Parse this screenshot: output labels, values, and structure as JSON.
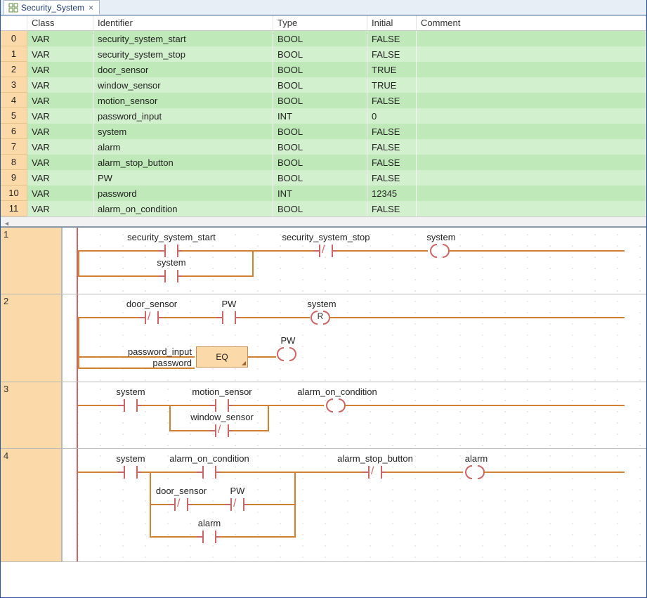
{
  "tab": {
    "title": "Security_System",
    "close": "×"
  },
  "vartable": {
    "headers": {
      "class": "Class",
      "identifier": "Identifier",
      "type": "Type",
      "initial": "Initial",
      "comment": "Comment"
    },
    "rows": [
      {
        "idx": "0",
        "class": "VAR",
        "identifier": "security_system_start",
        "type": "BOOL",
        "initial": "FALSE",
        "comment": ""
      },
      {
        "idx": "1",
        "class": "VAR",
        "identifier": "security_system_stop",
        "type": "BOOL",
        "initial": "FALSE",
        "comment": ""
      },
      {
        "idx": "2",
        "class": "VAR",
        "identifier": "door_sensor",
        "type": "BOOL",
        "initial": "TRUE",
        "comment": ""
      },
      {
        "idx": "3",
        "class": "VAR",
        "identifier": "window_sensor",
        "type": "BOOL",
        "initial": "TRUE",
        "comment": ""
      },
      {
        "idx": "4",
        "class": "VAR",
        "identifier": "motion_sensor",
        "type": "BOOL",
        "initial": "FALSE",
        "comment": ""
      },
      {
        "idx": "5",
        "class": "VAR",
        "identifier": "password_input",
        "type": "INT",
        "initial": "0",
        "comment": ""
      },
      {
        "idx": "6",
        "class": "VAR",
        "identifier": "system",
        "type": "BOOL",
        "initial": "FALSE",
        "comment": ""
      },
      {
        "idx": "7",
        "class": "VAR",
        "identifier": "alarm",
        "type": "BOOL",
        "initial": "FALSE",
        "comment": ""
      },
      {
        "idx": "8",
        "class": "VAR",
        "identifier": "alarm_stop_button",
        "type": "BOOL",
        "initial": "FALSE",
        "comment": ""
      },
      {
        "idx": "9",
        "class": "VAR",
        "identifier": "PW",
        "type": "BOOL",
        "initial": "FALSE",
        "comment": ""
      },
      {
        "idx": "10",
        "class": "VAR",
        "identifier": "password",
        "type": "INT",
        "initial": "12345",
        "comment": ""
      },
      {
        "idx": "11",
        "class": "VAR",
        "identifier": "alarm_on_condition",
        "type": "BOOL",
        "initial": "FALSE",
        "comment": ""
      }
    ]
  },
  "rungs": [
    {
      "num": "1",
      "elements": [
        {
          "t": "contact",
          "neg": false,
          "label": "security_system_start"
        },
        {
          "t": "contact",
          "neg": true,
          "label": "security_system_stop"
        },
        {
          "t": "coil",
          "letter": "",
          "label": "system"
        },
        {
          "t": "branch",
          "label": "system"
        }
      ]
    },
    {
      "num": "2",
      "elements": [
        {
          "t": "contact",
          "neg": true,
          "label": "door_sensor"
        },
        {
          "t": "contact",
          "neg": false,
          "label": "PW"
        },
        {
          "t": "coil",
          "letter": "R",
          "label": "system"
        },
        {
          "t": "fn",
          "name": "EQ",
          "in": [
            "password_input",
            "password"
          ],
          "out_coil": "PW"
        }
      ]
    },
    {
      "num": "3",
      "elements": [
        {
          "t": "contact",
          "neg": false,
          "label": "system"
        },
        {
          "t": "contact",
          "neg": false,
          "label": "motion_sensor"
        },
        {
          "t": "coil",
          "letter": "",
          "label": "alarm_on_condition"
        },
        {
          "t": "branch",
          "neg": true,
          "label": "window_sensor"
        }
      ]
    },
    {
      "num": "4",
      "elements": [
        {
          "t": "contact",
          "neg": false,
          "label": "system"
        },
        {
          "t": "contact",
          "neg": false,
          "label": "alarm_on_condition"
        },
        {
          "t": "contact",
          "neg": true,
          "label": "alarm_stop_button"
        },
        {
          "t": "coil",
          "letter": "",
          "label": "alarm"
        },
        {
          "t": "branch1",
          "c1": {
            "neg": true,
            "label": "door_sensor"
          },
          "c2": {
            "neg": true,
            "label": "PW"
          }
        },
        {
          "t": "branch2",
          "label": "alarm"
        }
      ]
    }
  ]
}
